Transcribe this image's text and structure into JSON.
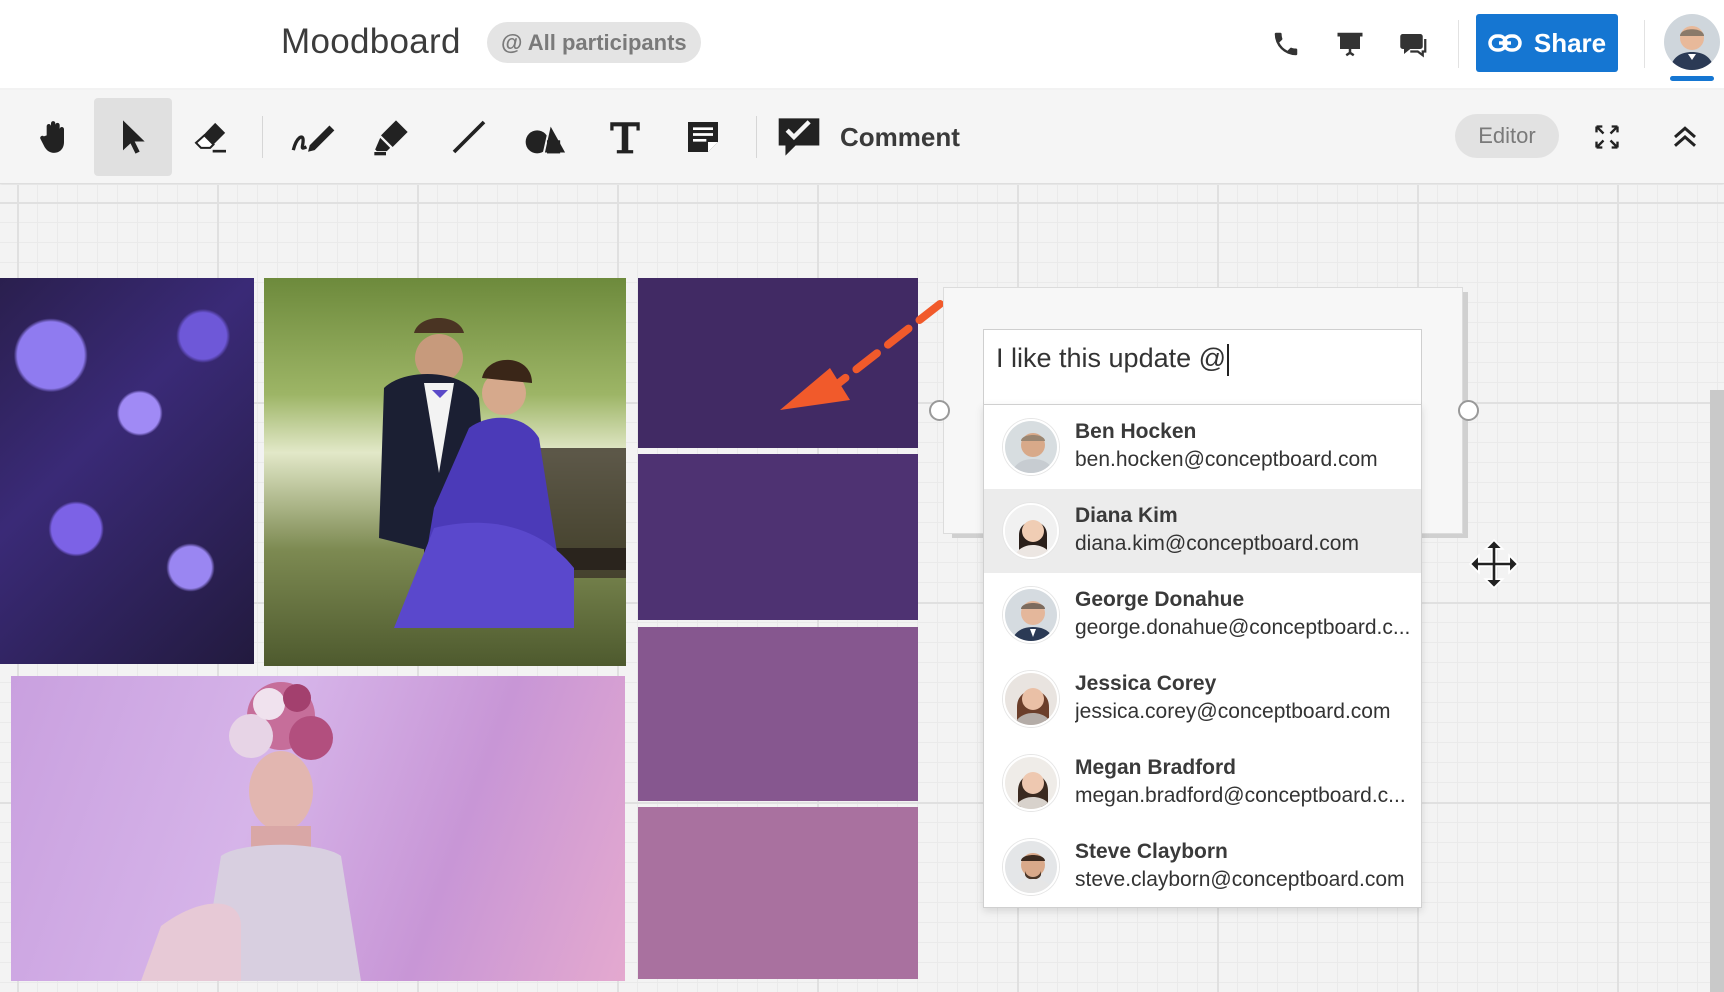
{
  "header": {
    "title": "Moodboard",
    "participants_label": "@ All participants",
    "share_label": "Share",
    "icons": [
      "phone-icon",
      "presentation-icon",
      "chat-icon",
      "link-icon"
    ]
  },
  "toolbar": {
    "tools": [
      "hand-icon",
      "select-arrow-icon",
      "eraser-icon",
      "pen-icon",
      "highlighter-icon",
      "line-icon",
      "shapes-icon",
      "text-icon",
      "sticky-note-icon",
      "comment-icon"
    ],
    "comment_label": "Comment",
    "editor_label": "Editor"
  },
  "comment": {
    "input_text": "I like this update @"
  },
  "mentions": [
    {
      "name": "Ben Hocken",
      "email": "ben.hocken@conceptboard.com",
      "highlighted": false
    },
    {
      "name": "Diana Kim",
      "email": "diana.kim@conceptboard.com",
      "highlighted": true
    },
    {
      "name": "George Donahue",
      "email": "george.donahue@conceptboard.c...",
      "highlighted": false
    },
    {
      "name": "Jessica Corey",
      "email": "jessica.corey@conceptboard.com",
      "highlighted": false
    },
    {
      "name": "Megan Bradford",
      "email": "megan.bradford@conceptboard.c...",
      "highlighted": false
    },
    {
      "name": "Steve Clayborn",
      "email": "steve.clayborn@conceptboard.com",
      "highlighted": false
    }
  ],
  "colors": {
    "accent": "#1576d2",
    "swatches": [
      "#412a64",
      "#4e3272",
      "#86578f",
      "#a9719f"
    ],
    "annotation_arrow": "#f15a2b"
  }
}
